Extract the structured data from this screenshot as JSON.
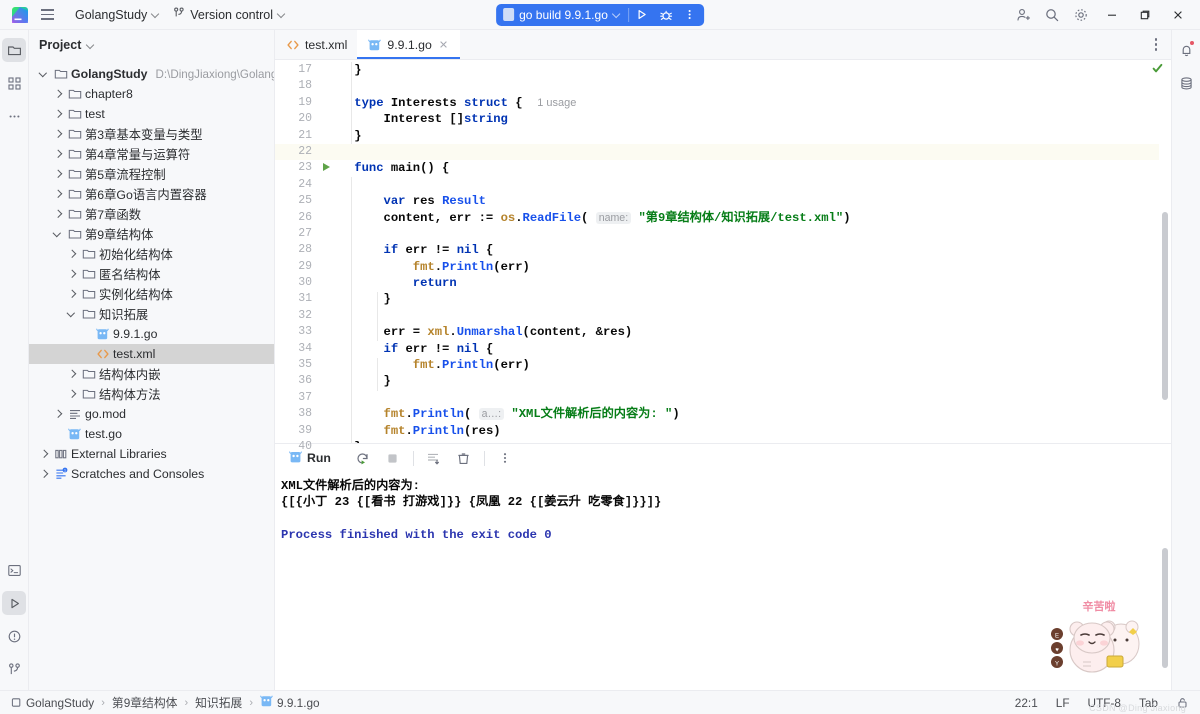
{
  "window": {
    "title": "GolangStudy",
    "project_name": "GolangStudy",
    "version_control": "Version control",
    "logo_icon": "goland-logo-icon",
    "menu_icon": "hamburger-menu-icon"
  },
  "toolbar": {
    "run_config": "go build 9.9.1.go",
    "run_icon": "run-play-icon",
    "debug_icon": "debug-bug-icon",
    "more_icon": "more-vertical-icon",
    "accent_color": "#3574f0",
    "right_icons": [
      {
        "name": "add-user-icon"
      },
      {
        "name": "search-icon"
      },
      {
        "name": "settings-gear-icon"
      }
    ],
    "window_controls": [
      {
        "name": "minimize-button"
      },
      {
        "name": "maximize-button"
      },
      {
        "name": "close-button"
      }
    ]
  },
  "left_stripe": [
    {
      "name": "project-tool-icon",
      "active": true
    },
    {
      "name": "structure-tool-icon",
      "active": false
    },
    {
      "name": "more-tools-icon",
      "active": false
    }
  ],
  "left_stripe_bottom": [
    {
      "name": "terminal-tool-icon",
      "active": false
    },
    {
      "name": "run-tool-icon",
      "active": true
    },
    {
      "name": "problems-tool-icon",
      "active": false
    },
    {
      "name": "git-branch-icon",
      "active": false
    }
  ],
  "right_stripe": [
    {
      "name": "notifications-bell-icon",
      "badge": true
    },
    {
      "name": "database-tool-icon",
      "badge": false
    }
  ],
  "project_panel": {
    "header": "Project",
    "header_chevron": "chevron-down-icon",
    "tree": [
      {
        "depth": 0,
        "label": "GolangStudy",
        "path": "D:\\DingJiaxiong\\GolangStudy",
        "icon": "folder-icon",
        "state": "open",
        "bold": true,
        "selected": false
      },
      {
        "depth": 1,
        "label": "chapter8",
        "path": "",
        "icon": "folder-icon",
        "state": "closed",
        "bold": false,
        "selected": false
      },
      {
        "depth": 1,
        "label": "test",
        "path": "",
        "icon": "folder-icon",
        "state": "closed",
        "bold": false,
        "selected": false
      },
      {
        "depth": 1,
        "label": "第3章基本变量与类型",
        "path": "",
        "icon": "folder-icon",
        "state": "closed",
        "bold": false,
        "selected": false
      },
      {
        "depth": 1,
        "label": "第4章常量与运算符",
        "path": "",
        "icon": "folder-icon",
        "state": "closed",
        "bold": false,
        "selected": false
      },
      {
        "depth": 1,
        "label": "第5章流程控制",
        "path": "",
        "icon": "folder-icon",
        "state": "closed",
        "bold": false,
        "selected": false
      },
      {
        "depth": 1,
        "label": "第6章Go语言内置容器",
        "path": "",
        "icon": "folder-icon",
        "state": "closed",
        "bold": false,
        "selected": false
      },
      {
        "depth": 1,
        "label": "第7章函数",
        "path": "",
        "icon": "folder-icon",
        "state": "closed",
        "bold": false,
        "selected": false
      },
      {
        "depth": 1,
        "label": "第9章结构体",
        "path": "",
        "icon": "folder-icon",
        "state": "open",
        "bold": false,
        "selected": false
      },
      {
        "depth": 2,
        "label": "初始化结构体",
        "path": "",
        "icon": "folder-icon",
        "state": "closed",
        "bold": false,
        "selected": false
      },
      {
        "depth": 2,
        "label": "匿名结构体",
        "path": "",
        "icon": "folder-icon",
        "state": "closed",
        "bold": false,
        "selected": false
      },
      {
        "depth": 2,
        "label": "实例化结构体",
        "path": "",
        "icon": "folder-icon",
        "state": "closed",
        "bold": false,
        "selected": false
      },
      {
        "depth": 2,
        "label": "知识拓展",
        "path": "",
        "icon": "folder-icon",
        "state": "open",
        "bold": false,
        "selected": false
      },
      {
        "depth": 3,
        "label": "9.9.1.go",
        "path": "",
        "icon": "go-file-icon",
        "state": "leaf",
        "bold": false,
        "selected": false
      },
      {
        "depth": 3,
        "label": "test.xml",
        "path": "",
        "icon": "xml-file-icon",
        "state": "leaf",
        "bold": false,
        "selected": true
      },
      {
        "depth": 2,
        "label": "结构体内嵌",
        "path": "",
        "icon": "folder-icon",
        "state": "closed",
        "bold": false,
        "selected": false
      },
      {
        "depth": 2,
        "label": "结构体方法",
        "path": "",
        "icon": "folder-icon",
        "state": "closed",
        "bold": false,
        "selected": false
      },
      {
        "depth": 1,
        "label": "go.mod",
        "path": "",
        "icon": "gomod-file-icon",
        "state": "closed",
        "bold": false,
        "selected": false
      },
      {
        "depth": 1,
        "label": "test.go",
        "path": "",
        "icon": "go-file-icon",
        "state": "leaf",
        "bold": false,
        "selected": false
      },
      {
        "depth": 0,
        "label": "External Libraries",
        "path": "",
        "icon": "library-icon",
        "state": "closed",
        "bold": false,
        "selected": false
      },
      {
        "depth": 0,
        "label": "Scratches and Consoles",
        "path": "",
        "icon": "scratches-icon",
        "state": "closed",
        "bold": false,
        "selected": false
      }
    ]
  },
  "editor": {
    "tabs": [
      {
        "label": "test.xml",
        "icon": "xml-file-icon",
        "active": false,
        "closable": false
      },
      {
        "label": "9.9.1.go",
        "icon": "go-file-icon",
        "active": true,
        "closable": true
      }
    ],
    "options_icon": "editor-options-kebab-icon",
    "inspection_status": "no-problems-check-icon",
    "first_visible_line": 17,
    "current_line": 22,
    "lines": [
      {
        "n": 17,
        "html": "    <span class=\"idt\">}</span>",
        "hl": false,
        "gutter_run": false
      },
      {
        "n": 18,
        "html": "",
        "hl": false,
        "gutter_run": false
      },
      {
        "n": 19,
        "html": "    <span class=\"kw\">type</span> <span class=\"idt\">Interests</span> <span class=\"kw\">struct</span> <span class=\"idt\">{</span>  <span class=\"usage\">1 usage</span>",
        "hl": false,
        "gutter_run": false
      },
      {
        "n": 20,
        "html": "        <span class=\"idt\">Interest []</span><span class=\"kw\">string</span>",
        "hl": false,
        "gutter_run": false
      },
      {
        "n": 21,
        "html": "    <span class=\"idt\">}</span>",
        "hl": false,
        "gutter_run": false
      },
      {
        "n": 22,
        "html": "",
        "hl": true,
        "gutter_run": false
      },
      {
        "n": 23,
        "html": "    <span class=\"kw\">func</span> <span class=\"idt\">main() {</span>",
        "hl": false,
        "gutter_run": true
      },
      {
        "n": 24,
        "html": "",
        "hl": false,
        "gutter_run": false
      },
      {
        "n": 25,
        "html": "        <span class=\"kw\">var</span> <span class=\"idt\">res</span> <span class=\"fn\">Result</span>",
        "hl": false,
        "gutter_run": false
      },
      {
        "n": 26,
        "html": "        <span class=\"idt\">content, err :=</span> <span class=\"pkg\">os</span><span class=\"idt\">.</span><span class=\"fn\">ReadFile</span><span class=\"idt\">(</span> <span class=\"hint\">name:</span> <span class=\"str\">\"第9章结构体/知识拓展/test.xml\"</span><span class=\"idt\">)</span>",
        "hl": false,
        "gutter_run": false
      },
      {
        "n": 27,
        "html": "",
        "hl": false,
        "gutter_run": false
      },
      {
        "n": 28,
        "html": "        <span class=\"kw\">if</span> <span class=\"idt\">err !=</span> <span class=\"kw\">nil</span> <span class=\"idt\">{</span>",
        "hl": false,
        "gutter_run": false
      },
      {
        "n": 29,
        "html": "            <span class=\"pkg\">fmt</span><span class=\"idt\">.</span><span class=\"fn\">Println</span><span class=\"idt\">(err)</span>",
        "hl": false,
        "gutter_run": false
      },
      {
        "n": 30,
        "html": "            <span class=\"kw\">return</span>",
        "hl": false,
        "gutter_run": false
      },
      {
        "n": 31,
        "html": "        <span class=\"idt\">}</span>",
        "hl": false,
        "gutter_run": false
      },
      {
        "n": 32,
        "html": "",
        "hl": false,
        "gutter_run": false
      },
      {
        "n": 33,
        "html": "        <span class=\"idt\">err =</span> <span class=\"pkg\">xml</span><span class=\"idt\">.</span><span class=\"fn\">Unmarshal</span><span class=\"idt\">(content, &amp;res)</span>",
        "hl": false,
        "gutter_run": false
      },
      {
        "n": 34,
        "html": "        <span class=\"kw\">if</span> <span class=\"idt\">err !=</span> <span class=\"kw\">nil</span> <span class=\"idt\">{</span>",
        "hl": false,
        "gutter_run": false
      },
      {
        "n": 35,
        "html": "            <span class=\"pkg\">fmt</span><span class=\"idt\">.</span><span class=\"fn\">Println</span><span class=\"idt\">(err)</span>",
        "hl": false,
        "gutter_run": false
      },
      {
        "n": 36,
        "html": "        <span class=\"idt\">}</span>",
        "hl": false,
        "gutter_run": false
      },
      {
        "n": 37,
        "html": "",
        "hl": false,
        "gutter_run": false
      },
      {
        "n": 38,
        "html": "        <span class=\"pkg\">fmt</span><span class=\"idt\">.</span><span class=\"fn\">Println</span><span class=\"idt\">(</span> <span class=\"hint\">a…:</span> <span class=\"str\">\"XML文件解析后的内容为: \"</span><span class=\"idt\">)</span>",
        "hl": false,
        "gutter_run": false
      },
      {
        "n": 39,
        "html": "        <span class=\"pkg\">fmt</span><span class=\"idt\">.</span><span class=\"fn\">Println</span><span class=\"idt\">(res)</span>",
        "hl": false,
        "gutter_run": false
      },
      {
        "n": 40,
        "html": "    <span class=\"idt\">}</span>",
        "hl": false,
        "gutter_run": false
      }
    ]
  },
  "run_panel": {
    "tab_label": "Run",
    "tab_icon": "go-run-icon",
    "buttons": [
      {
        "name": "rerun-button",
        "icon": "rerun-icon"
      },
      {
        "name": "stop-button",
        "icon": "stop-square-icon"
      },
      {
        "name": "scroll-to-end-button",
        "icon": "scroll-to-end-icon"
      },
      {
        "name": "clear-all-button",
        "icon": "trash-icon"
      },
      {
        "name": "run-options-button",
        "icon": "more-vertical-icon"
      }
    ],
    "output": [
      {
        "text": "XML文件解析后的内容为:",
        "kind": "stdout"
      },
      {
        "text": "{[{小丁 23 {[看书 打游戏]}} {凤凰 22 {[姜云升 吃零食]}}]}",
        "kind": "stdout"
      },
      {
        "text": "",
        "kind": "stdout"
      },
      {
        "text": "Process finished with the exit code 0",
        "kind": "exit"
      }
    ],
    "sticker": {
      "name": "cartoon-bear-sticker",
      "text": "辛苦啦"
    }
  },
  "status_bar": {
    "breadcrumbs": [
      {
        "label": "GolangStudy",
        "icon": "module-icon"
      },
      {
        "label": "第9章结构体",
        "icon": ""
      },
      {
        "label": "知识拓展",
        "icon": ""
      },
      {
        "label": "9.9.1.go",
        "icon": "go-file-icon"
      }
    ],
    "separator": "›",
    "caret_position": "22:1",
    "line_separator": "LF",
    "encoding": "UTF-8",
    "indent": "Tab",
    "lock_icon": "readonly-lock-icon",
    "watermark": "CSDN @Ding Jiaxiong"
  }
}
